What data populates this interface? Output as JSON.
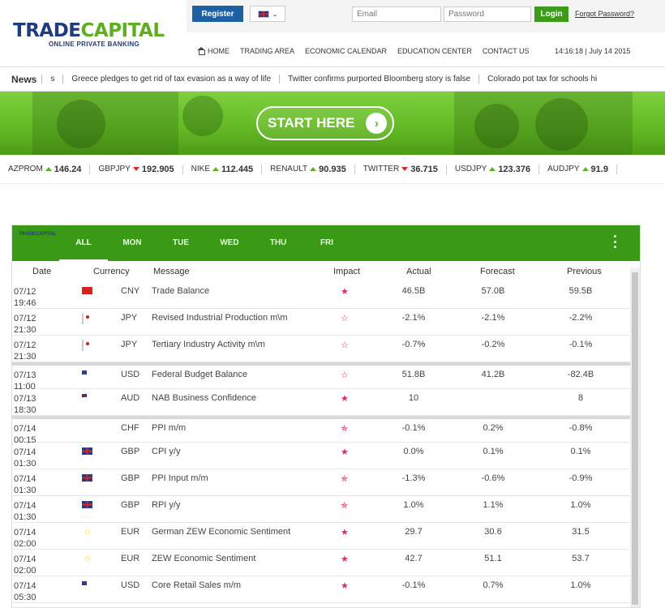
{
  "header": {
    "logo_part1": "TRADE",
    "logo_part2": "CAPITAL",
    "logo_sub": "ONLINE PRIVATE BANKING",
    "register_label": "Register",
    "email_placeholder": "Email",
    "password_placeholder": "Password",
    "login_label": "Login",
    "forgot_label": "Forgot Password?",
    "nav": [
      "HOME",
      "TRADING AREA",
      "ECONOMIC CALENDAR",
      "EDUCATION CENTER",
      "CONTACT US"
    ],
    "datetime": "14:16:18 | July 14 2015"
  },
  "news": {
    "label": "News",
    "items": [
      "s",
      "Greece pledges to get rid of tax evasion as a way of life",
      "Twitter confirms purported Bloomberg story is false",
      "Colorado pot tax for schools hi"
    ]
  },
  "banner": {
    "cta_label": "START HERE",
    "accent": "#5fae1f"
  },
  "quotes": [
    {
      "symbol": "AZPROM",
      "dir": "up",
      "value": "146.24"
    },
    {
      "symbol": "GBPJPY",
      "dir": "down",
      "value": "192.905"
    },
    {
      "symbol": "NIKE",
      "dir": "up",
      "value": "112.445"
    },
    {
      "symbol": "RENAULT",
      "dir": "up",
      "value": "90.935"
    },
    {
      "symbol": "TWITTER",
      "dir": "down",
      "value": "36.715"
    },
    {
      "symbol": "USDJPY",
      "dir": "up",
      "value": "123.376"
    },
    {
      "symbol": "AUDJPY",
      "dir": "up",
      "value": "91.9"
    }
  ],
  "calendar": {
    "logo_text": "TRADECAPITAL",
    "tabs": [
      "ALL",
      "MON",
      "TUE",
      "WED",
      "THU",
      "FRI"
    ],
    "columns": [
      "Date",
      "Currency",
      "Message",
      "Impact",
      "Actual",
      "Forecast",
      "Previous"
    ],
    "rows": [
      {
        "date": "07/12",
        "time": "19:46",
        "flag": "cn",
        "currency": "CNY",
        "message": "Trade Balance",
        "impact": "★",
        "actual": "46.5B",
        "forecast": "57.0B",
        "previous": "59.5B",
        "group_start": false
      },
      {
        "date": "07/12",
        "time": "21:30",
        "flag": "jp",
        "currency": "JPY",
        "message": "Revised Industrial Production m\\m",
        "impact": "☆",
        "actual": "-2.1%",
        "forecast": "-2.1%",
        "previous": "-2.2%",
        "group_start": false
      },
      {
        "date": "07/12",
        "time": "21:30",
        "flag": "jp",
        "currency": "JPY",
        "message": "Tertiary Industry Activity m\\m",
        "impact": "☆",
        "actual": "-0.7%",
        "forecast": "-0.2%",
        "previous": "-0.1%",
        "group_start": false
      },
      {
        "date": "07/13",
        "time": "11:00",
        "flag": "us",
        "currency": "USD",
        "message": "Federal Budget Balance",
        "impact": "☆",
        "actual": "51.8B",
        "forecast": "41.2B",
        "previous": "-82.4B",
        "group_start": true
      },
      {
        "date": "07/13",
        "time": "18:30",
        "flag": "au",
        "currency": "AUD",
        "message": "NAB Business Confidence",
        "impact": "★",
        "actual": "10",
        "forecast": "",
        "previous": "8",
        "group_start": false
      },
      {
        "date": "07/14",
        "time": "00:15",
        "flag": "ch",
        "currency": "CHF",
        "message": "PPI m/m",
        "impact": "✯",
        "actual": "-0.1%",
        "forecast": "0.2%",
        "previous": "-0.8%",
        "group_start": true
      },
      {
        "date": "07/14",
        "time": "01:30",
        "flag": "gb",
        "currency": "GBP",
        "message": "CPI y/y",
        "impact": "★",
        "actual": "0.0%",
        "forecast": "0.1%",
        "previous": "0.1%",
        "group_start": false
      },
      {
        "date": "07/14",
        "time": "01:30",
        "flag": "gb",
        "currency": "GBP",
        "message": "PPI Input m/m",
        "impact": "✯",
        "actual": "-1.3%",
        "forecast": "-0.6%",
        "previous": "-0.9%",
        "group_start": false
      },
      {
        "date": "07/14",
        "time": "01:30",
        "flag": "gb",
        "currency": "GBP",
        "message": "RPI y/y",
        "impact": "✯",
        "actual": "1.0%",
        "forecast": "1.1%",
        "previous": "1.0%",
        "group_start": false
      },
      {
        "date": "07/14",
        "time": "02:00",
        "flag": "eu",
        "currency": "EUR",
        "message": "German ZEW Economic Sentiment",
        "impact": "★",
        "actual": "29.7",
        "forecast": "30.6",
        "previous": "31.5",
        "group_start": false
      },
      {
        "date": "07/14",
        "time": "02:00",
        "flag": "eu",
        "currency": "EUR",
        "message": "ZEW Economic Sentiment",
        "impact": "★",
        "actual": "42.7",
        "forecast": "51.1",
        "previous": "53.7",
        "group_start": false
      },
      {
        "date": "07/14",
        "time": "05:30",
        "flag": "us",
        "currency": "USD",
        "message": "Core Retail Sales m/m",
        "impact": "★",
        "actual": "-0.1%",
        "forecast": "0.7%",
        "previous": "1.0%",
        "group_start": false
      }
    ]
  }
}
